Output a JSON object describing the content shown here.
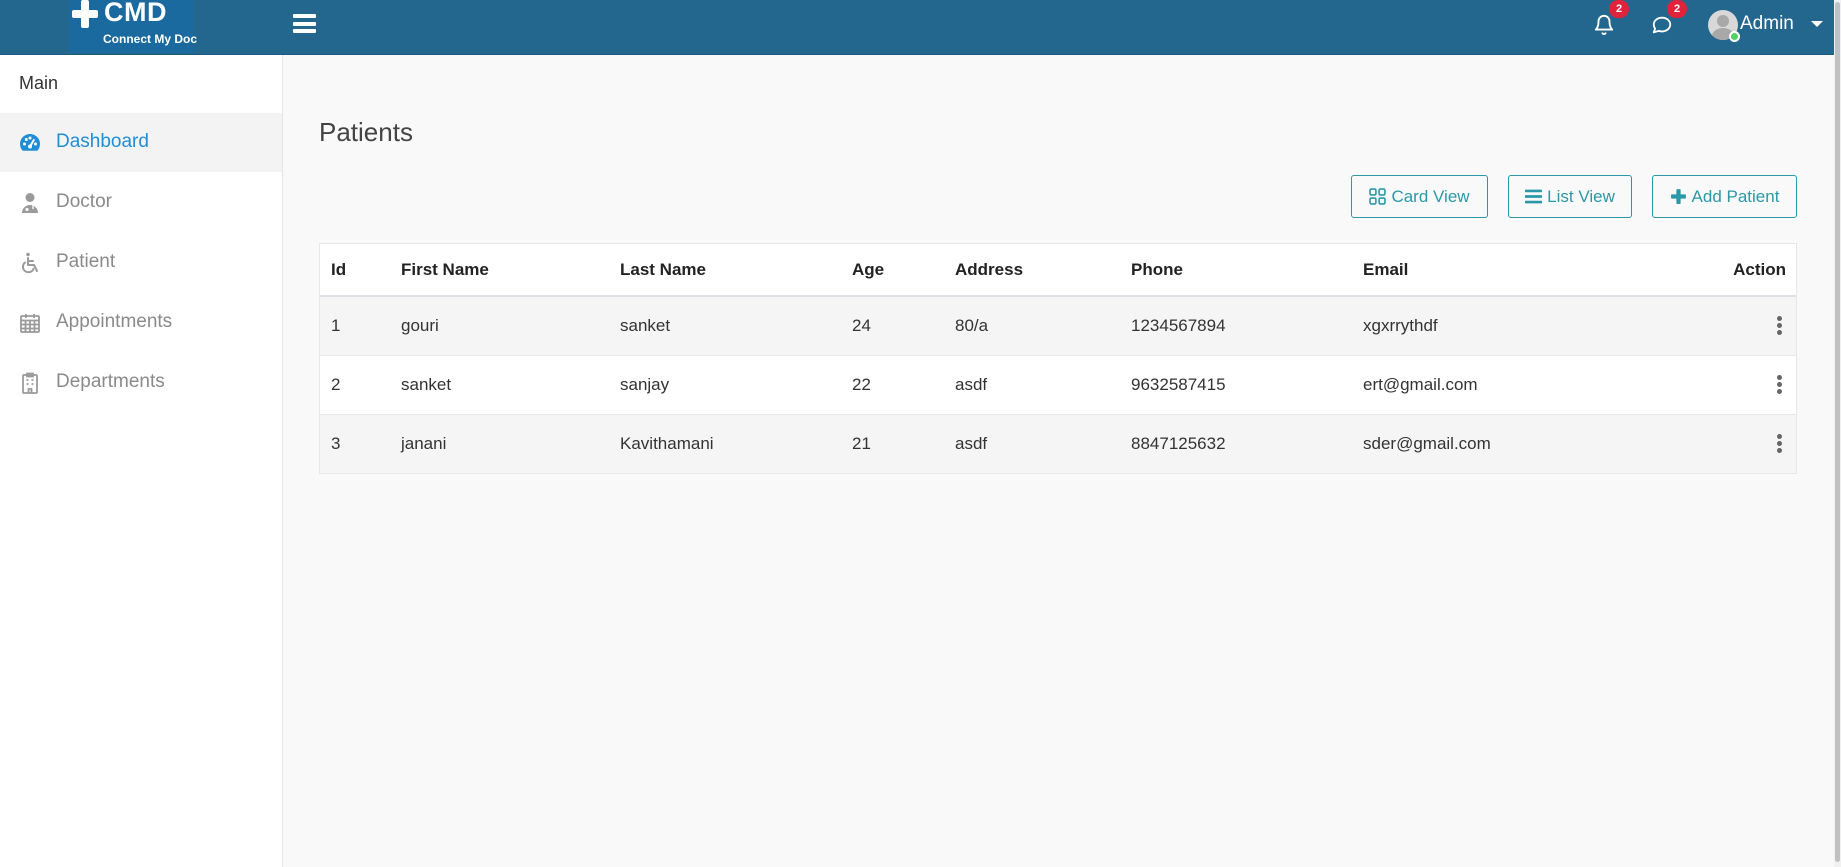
{
  "brand": {
    "name": "CMD",
    "tagline": "Connect My Doc"
  },
  "header": {
    "notifications_count": "2",
    "messages_count": "2",
    "user_name": "Admin"
  },
  "sidebar": {
    "title": "Main",
    "items": [
      {
        "label": "Dashboard",
        "icon": "dashboard-icon",
        "active": true
      },
      {
        "label": "Doctor",
        "icon": "doctor-icon",
        "active": false
      },
      {
        "label": "Patient",
        "icon": "wheelchair-icon",
        "active": false
      },
      {
        "label": "Appointments",
        "icon": "calendar-icon",
        "active": false
      },
      {
        "label": "Departments",
        "icon": "hospital-icon",
        "active": false
      }
    ]
  },
  "page": {
    "title": "Patients",
    "buttons": {
      "card_view": "Card View",
      "list_view": "List View",
      "add_patient": "Add Patient"
    }
  },
  "table": {
    "columns": [
      "Id",
      "First Name",
      "Last Name",
      "Age",
      "Address",
      "Phone",
      "Email",
      "Action"
    ],
    "rows": [
      {
        "id": "1",
        "first_name": "gouri",
        "last_name": "sanket",
        "age": "24",
        "address": "80/a",
        "phone": "1234567894",
        "email": "xgxrrythdf"
      },
      {
        "id": "2",
        "first_name": "sanket",
        "last_name": "sanjay",
        "age": "22",
        "address": "asdf",
        "phone": "9632587415",
        "email": "ert@gmail.com"
      },
      {
        "id": "3",
        "first_name": "janani",
        "last_name": "Kavithamani",
        "age": "21",
        "address": "asdf",
        "phone": "8847125632",
        "email": "sder@gmail.com"
      }
    ]
  },
  "colors": {
    "topbar": "#23678f",
    "accent_blue": "#1f8ed6",
    "button_teal": "#2b98a8",
    "badge_red": "#e0233b",
    "online_green": "#55ce63"
  }
}
